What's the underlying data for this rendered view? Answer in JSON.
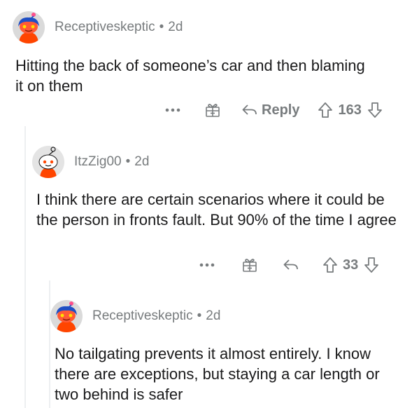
{
  "comments": [
    {
      "username": "Receptiveskeptic",
      "age": "2d",
      "separator": "•",
      "body": "Hitting the back of someone’s car and then blaming it on them",
      "reply_label": "Reply",
      "votes": "163",
      "avatar_palette": {
        "hair": "#1f4fc4",
        "face": "#ff5a36",
        "shirt": "#ff4500",
        "antenna": "#ff4f8b"
      }
    },
    {
      "username": "ItzZig00",
      "age": "2d",
      "separator": "•",
      "body": "I think there are certain scenarios where it could be the person in fronts fault. But 90% of the time I agree",
      "reply_label": "",
      "votes": "33",
      "avatar_palette": {
        "hair": "#ffffff",
        "face": "#ff5a36",
        "shirt": "#ff4500",
        "antenna": "#ff4f8b"
      }
    },
    {
      "username": "Receptiveskeptic",
      "age": "2d",
      "separator": "•",
      "body": "No tailgating prevents it almost entirely. I know there are exceptions, but staying a car length or two behind is safer",
      "avatar_palette": {
        "hair": "#1f4fc4",
        "face": "#ff5a36",
        "shirt": "#ff4500",
        "antenna": "#ff4f8b"
      }
    }
  ],
  "icons": {
    "more": "more-options-icon",
    "award": "award-gift-icon",
    "reply": "reply-arrow-icon",
    "upvote": "upvote-arrow-icon",
    "downvote": "downvote-arrow-icon"
  }
}
